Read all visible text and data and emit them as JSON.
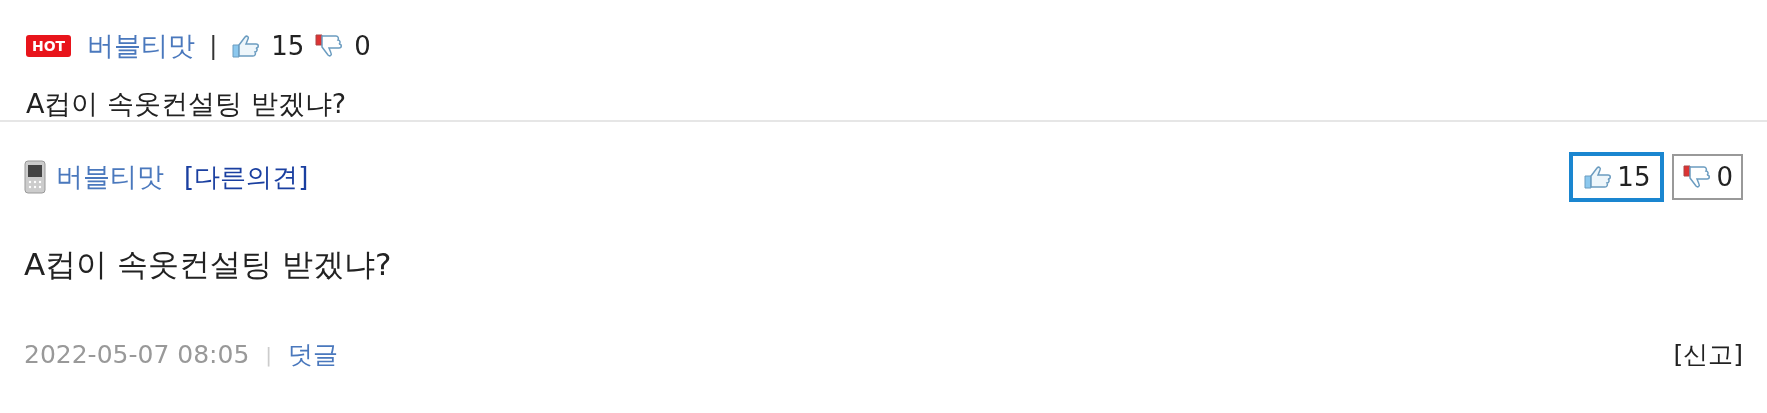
{
  "hot_comment": {
    "badge": "HOT",
    "author": "버블티맛",
    "separator": "|",
    "likes": "15",
    "dislikes": "0",
    "body": "A컵이 속옷컨설팅 받겠냐?"
  },
  "comment": {
    "author": "버블티맛",
    "tag": "[다른의견]",
    "votes": [
      {
        "kind": "up",
        "count": "15",
        "selected": true
      },
      {
        "kind": "down",
        "count": "0",
        "selected": false
      }
    ],
    "body": "A컵이 속옷컨설팅 받겠냐?",
    "date": "2022-05-07 08:05",
    "separator": "|",
    "reply": "덧글",
    "report": "[신고]"
  }
}
